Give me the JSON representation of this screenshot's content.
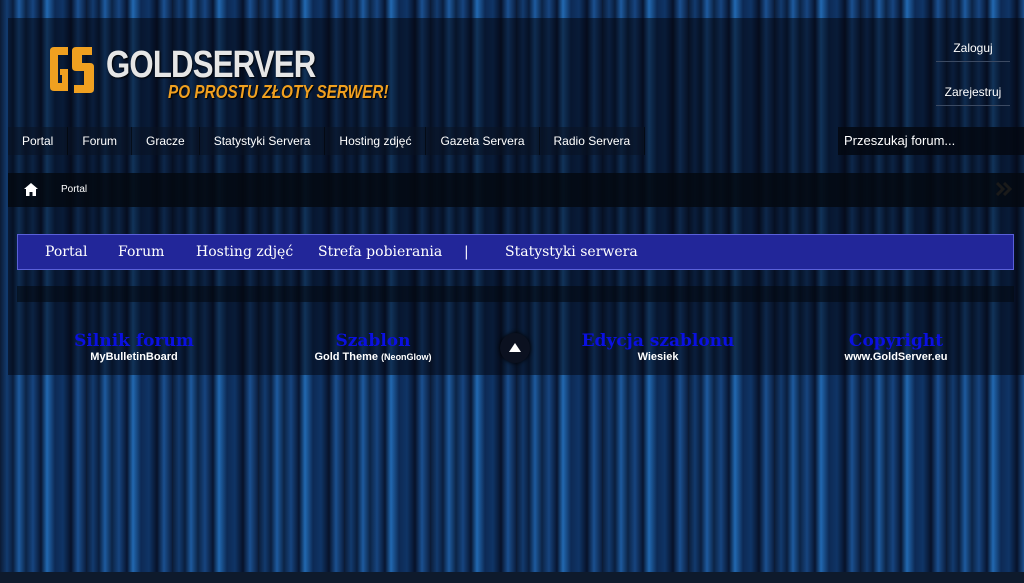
{
  "header": {
    "logo_text": "GOLDSERVER",
    "tagline": "PO PROSTU ZŁOTY SERWER!",
    "login_label": "Zaloguj",
    "register_label": "Zarejestruj"
  },
  "topnav": {
    "items": [
      "Portal",
      "Forum",
      "Gracze",
      "Statystyki Servera",
      "Hosting zdjęć",
      "Gazeta Servera",
      "Radio Servera"
    ],
    "search_placeholder": "Przeszukaj forum..."
  },
  "breadcrumb": {
    "current": "Portal"
  },
  "portal_nav": {
    "items": [
      "Portal",
      "Forum",
      "Hosting zdjęć",
      "Strefa pobierania",
      "|",
      "Statystyki serwera"
    ]
  },
  "footer": {
    "engine_heading": "Silnik forum",
    "engine_value": "MyBulletinBoard",
    "theme_heading": "Szablon",
    "theme_value": "Gold Theme",
    "theme_suffix": "(NeonGlow)",
    "edit_heading": "Edycja szablonu",
    "edit_value": "Wiesiek",
    "copyright_heading": "Copyright",
    "copyright_value": "www.GoldServer.eu"
  },
  "colors": {
    "accent_gold": "#f0a020",
    "portal_nav_bg": "#222699",
    "footer_heading": "#0a10e0"
  },
  "icons": [
    "home-icon",
    "double-chevron-right-icon",
    "arrow-up-icon"
  ]
}
